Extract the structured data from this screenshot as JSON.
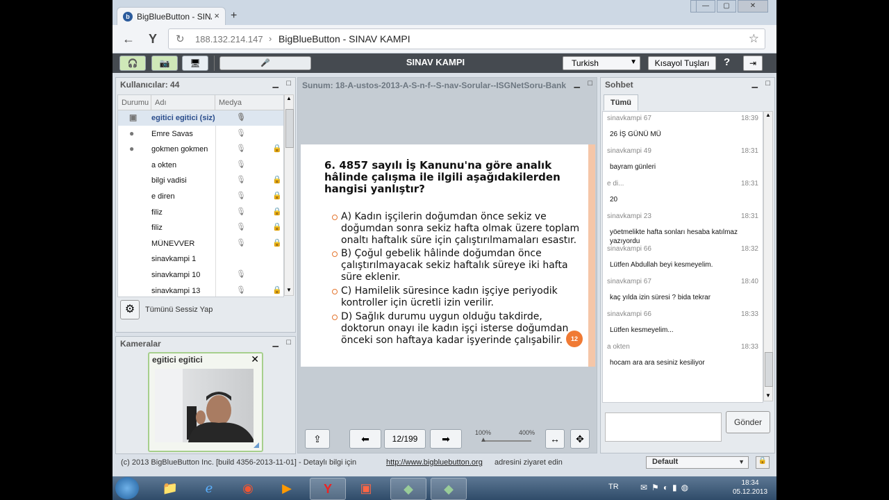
{
  "browser": {
    "tab_title": "BigBlueButton - SINAV",
    "new_tab": "+",
    "url_host": "188.132.214.147",
    "url_sep": "›",
    "page_title": "BigBlueButton - SINAV KAMPI"
  },
  "toolbar": {
    "app_name": "SINAV KAMPI",
    "language": "Turkish",
    "shortcuts": "Kısayol Tuşları",
    "help": "?"
  },
  "users": {
    "title": "Kullanıcılar: 44",
    "col_status": "Durumu",
    "col_name": "Adı",
    "col_media": "Medya",
    "rows": [
      {
        "name": "egitici egitici (siz)",
        "highlight": true
      },
      {
        "name": "Emre Savas"
      },
      {
        "name": "gokmen gokmen"
      },
      {
        "name": "a okten"
      },
      {
        "name": "bilgi vadisi"
      },
      {
        "name": "e diren"
      },
      {
        "name": "filiz"
      },
      {
        "name": "filiz"
      },
      {
        "name": "MÜNEVVER"
      },
      {
        "name": "sinavkampi 1"
      },
      {
        "name": "sinavkampi 10"
      },
      {
        "name": "sinavkampi 13"
      }
    ],
    "mute_all": "Tümünü Sessiz Yap"
  },
  "cameras": {
    "title": "Kameralar",
    "card_name": "egitici egitici"
  },
  "presentation": {
    "title": "Sunum: 18-A-ustos-2013-A-S-n-f--S-nav-Sorular--ISGNetSoru-Bank",
    "question": "6. 4857 sayılı İş Kanunu'na göre analık hâlinde çalışma ile ilgili aşağıdakilerden hangisi yanlıştır?",
    "options": [
      "A) Kadın işçilerin doğumdan önce sekiz ve doğumdan sonra sekiz hafta olmak üzere toplam onaltı haftalık süre için çalıştırılmamaları esastır.",
      "B) Çoğul gebelik hâlinde doğumdan önce çalıştırılmayacak sekiz haftalık süreye iki hafta süre eklenir.",
      "C) Hamilelik süresince kadın işçiye periyodik kontroller için ücretli izin verilir.",
      "D) Sağlık durumu uygun olduğu takdirde, doktorun onayı ile kadın işçi isterse doğumdan önceki son haftaya kadar işyerinde çalışabilir."
    ],
    "slide_badge": "12",
    "page_indicator": "12/199",
    "zoom_min": "100%",
    "zoom_max": "400%"
  },
  "chat": {
    "title": "Sohbet",
    "tab": "Tümü",
    "messages": [
      {
        "who": "sinavkampi 67",
        "time": "18:39",
        "text": "26 İŞ GÜNÜ MÜ"
      },
      {
        "who": "sinavkampi 49",
        "time": "18:31",
        "text": "bayram günleri"
      },
      {
        "who": "e di...",
        "time": "18:31",
        "text": "20"
      },
      {
        "who": "sinavkampi 23",
        "time": "18:31",
        "text": "yöetmelikte hafta sonları hesaba katılmaz yazıyordu"
      },
      {
        "who": "sinavkampi 66",
        "time": "18:32",
        "text": "Lütfen Abdullah beyi kesmeyelim."
      },
      {
        "who": "sinavkampi 67",
        "time": "18:40",
        "text": "kaç yılda izin süresi ? bida tekrar"
      },
      {
        "who": "sinavkampi 66",
        "time": "18:33",
        "text": "Lütfen kesmeyelim..."
      },
      {
        "who": "a okten",
        "time": "18:33",
        "text": "hocam ara ara sesiniz kesiliyor"
      }
    ],
    "send": "Gönder"
  },
  "footer": {
    "text": "(c) 2013 BigBlueButton Inc. [build 4356-2013-11-01] - Detaylı bilgi için",
    "link": "http://www.bigbluebutton.org",
    "suffix": "adresini ziyaret edin",
    "layout": "Default"
  },
  "taskbar": {
    "lang": "TR",
    "time": "18:34",
    "date": "05.12.2013"
  }
}
